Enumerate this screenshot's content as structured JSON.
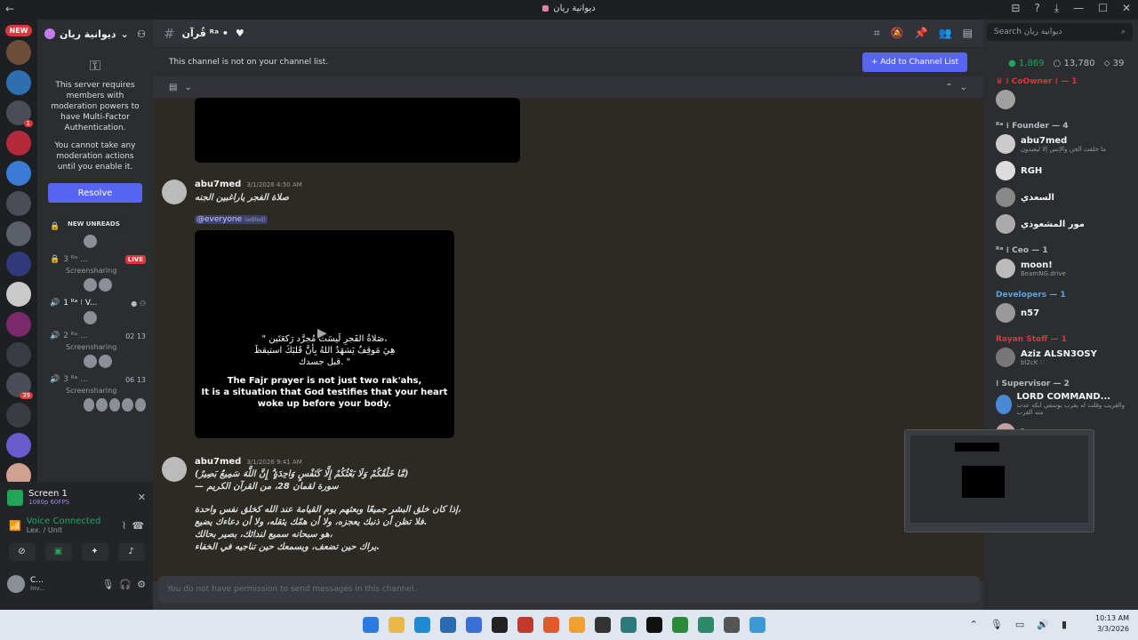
{
  "window": {
    "title": "ديوانية ريان",
    "nav": "←",
    "controls": [
      "⊟",
      "?",
      "⤓",
      "—",
      "☐",
      "✕"
    ]
  },
  "guilds": {
    "new_label": "NEW",
    "items": [
      {
        "color": "#6b4f3a",
        "badge": ""
      },
      {
        "color": "#2f6fb0",
        "badge": ""
      },
      {
        "color": "#4a4c56",
        "badge": "1"
      },
      {
        "color": "#b42a3a",
        "badge": ""
      },
      {
        "color": "#3a7bd5",
        "badge": ""
      },
      {
        "color": "#4a4c56",
        "badge": ""
      },
      {
        "color": "#5a5f6a",
        "badge": ""
      },
      {
        "color": "#303a78",
        "badge": ""
      },
      {
        "color": "#c9c9c9",
        "badge": ""
      },
      {
        "color": "#7a2a6a",
        "badge": ""
      },
      {
        "color": "#3a3c44",
        "badge": ""
      },
      {
        "color": "#4a4c56",
        "badge": "39"
      },
      {
        "color": "#3a3c44",
        "badge": ""
      },
      {
        "color": "#6a5acd",
        "badge": ""
      },
      {
        "color": "#d0a090",
        "badge": ""
      },
      {
        "color": "#c89090",
        "badge": ""
      }
    ]
  },
  "sidebar": {
    "server_name": "ديوانية ريان",
    "mfa": {
      "line1": "This server requires members with moderation powers to have Multi-Factor Authentication.",
      "line2": "You cannot take any moderation actions until you enable it.",
      "button": "Resolve"
    },
    "new_unreads": "NEW UNREADS",
    "voice_channels": [
      {
        "name": "3 ᴿᵃ ...",
        "status": "Screensharing",
        "live": "LIVE",
        "count": ""
      },
      {
        "name": "1 ᴿᵃ ⁝ V...",
        "status": "",
        "live": "",
        "count": ""
      },
      {
        "name": "2 ᴿᵃ ...",
        "status": "Screensharing",
        "live": "",
        "count": "02   13"
      },
      {
        "name": "3 ᴿᵃ ...",
        "status": "Screensharing",
        "live": "",
        "count": "06   13"
      }
    ],
    "screen": {
      "title": "Screen 1",
      "sub": "1080p 60FPS"
    },
    "voice": {
      "title": "Voice Connected",
      "sub": "Lex. / Unit"
    },
    "user": {
      "name": "C...",
      "status": "Inv..."
    }
  },
  "channel": {
    "name": "قُرآن ᴿᵃ •",
    "notice": "This channel is not on your channel list.",
    "add_button": "+ Add to Channel List",
    "input_placeholder": "You do not have permission to send messages in this channel."
  },
  "messages": [
    {
      "author": "abu7med",
      "time": "3/1/2026 4:50 AM",
      "text": "صلاة الفجر ياراغبين الجنه",
      "mention": "@everyone",
      "edited": "(edited)",
      "caption": [
        "\" صَلاةُ الفَجرِ لَيسَت مُجرَّد رَكعَتَين،",
        "هِيَ مَوقِفٌ يَشهَدُ اللهُ بِأنَّ قَلبَكَ استيقظَ",
        "قبل جسدك. \"",
        "",
        "The Fajr prayer is not just two rak'ahs,",
        "It is a situation that God testifies that your heart",
        "woke up before your body."
      ]
    },
    {
      "author": "abu7med",
      "time": "3/1/2026 9:41 AM",
      "lines": [
        "(مَّا خَلْقُكُمْ وَلَا بَعْثُكُمْ إِلَّا كَنَفْسٍ وَاحِدَةٍ ۗ إِنَّ اللَّهَ سَمِيعٌ بَصِيرٌ)",
        "— سورة لقمان 28، من القرآن الكريم",
        "",
        "إذا كان خلق البشر جميعًا وبعثهم يوم القيامة عند الله كخلق نفس واحدة،",
        "فلا تظن أن ذنبك يعجزه، ولا أن همّك يثقله، ولا أن دعاءك يضيع.",
        "هو سبحانه سميع لندائك، بصير بحالك،",
        "يراك حين تضعف، ويسمعك حين تناجيه في الخفاء."
      ]
    }
  ],
  "members": {
    "search_placeholder": "Search ديوانية ريان",
    "online": "1,869",
    "total": "13,780",
    "boosts": "39",
    "groups": [
      {
        "role": "♛ ⁝ CoOwner ⁝ — 1",
        "role_color": "#da373c",
        "items": [
          {
            "name": "",
            "sub": "",
            "color": "#a0a0a0"
          }
        ]
      },
      {
        "role": "ᴿᵃ ⁝ Founder — 4",
        "role_color": "#b5bac1",
        "items": [
          {
            "name": "abu7med",
            "sub": "ما خلقت الجن والإنس إلا ليعبدون",
            "color": "#ccc"
          },
          {
            "name": "RGH",
            "sub": "",
            "color": "#ddd"
          },
          {
            "name": "السعدي",
            "sub": "",
            "color": "#888"
          },
          {
            "name": "مور المشعوذي",
            "sub": "",
            "color": "#aaa"
          }
        ]
      },
      {
        "role": "ᴿᵃ ⁝ Ceo — 1",
        "role_color": "#b5bac1",
        "items": [
          {
            "name": "moon!",
            "sub": "BeamNG.drive",
            "color": "#bbb"
          }
        ]
      },
      {
        "role": "Developers — 1",
        "role_color": "#5ba4d6",
        "items": [
          {
            "name": "n57",
            "sub": "",
            "color": "#999"
          }
        ]
      },
      {
        "role": "Rayan Staff — 1",
        "role_color": "#da373c",
        "items": [
          {
            "name": "Aziz ALSN3OSY",
            "sub": "bl2cK ♡",
            "color": "#777"
          }
        ]
      },
      {
        "role": "⁝ Supervisor — 2",
        "role_color": "#b5bac1",
        "items": [
          {
            "name": "LORD COMMAND...",
            "sub": "والقريب وقلت له يقرب يوسفي ابكه عدت منه القرب",
            "color": "#4a8ad4"
          },
          {
            "name": "ᴿᵃ ⁝ F",
            "sub": "",
            "color": "#c0a0a0"
          }
        ]
      }
    ]
  },
  "taskbar": {
    "time": "10:13 AM",
    "date": "3/3/2026",
    "apps": [
      "#2a7ae2",
      "#e8b84a",
      "#1f8ad4",
      "#2a6ab0",
      "#3a6fd8",
      "#222",
      "#c0392b",
      "#e05a2a",
      "#f0a030",
      "#333",
      "#2a7a7a",
      "#111",
      "#2a8a3a",
      "#2a8a6a",
      "#555",
      "#3a9ad4"
    ]
  }
}
